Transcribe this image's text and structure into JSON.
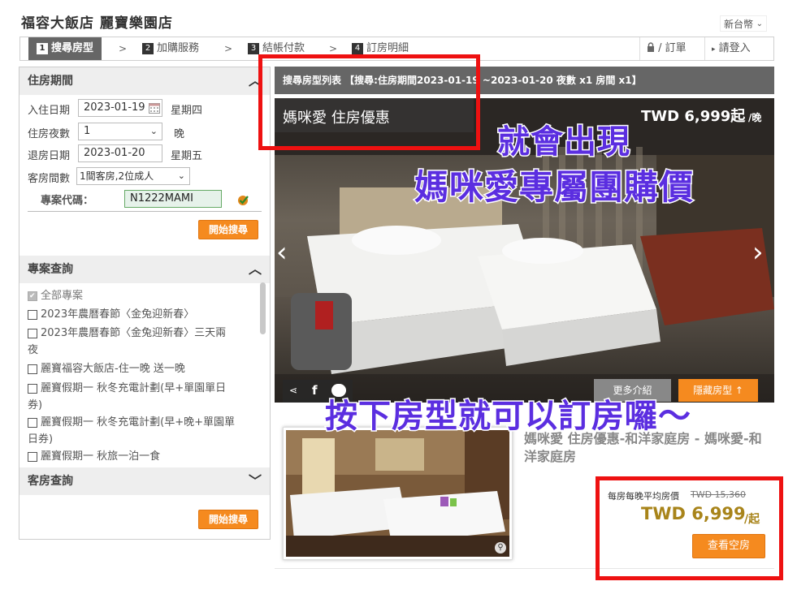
{
  "header": {
    "title": "福容大飯店 麗寶樂園店",
    "currency": "新台幣"
  },
  "steps": [
    {
      "num": "1",
      "label": "搜尋房型"
    },
    {
      "num": "2",
      "label": "加購服務"
    },
    {
      "num": "3",
      "label": "結帳付款"
    },
    {
      "num": "4",
      "label": "訂房明細"
    }
  ],
  "step_arrow": ">",
  "topright": {
    "order": "/ 訂單",
    "login": "請登入"
  },
  "stay": {
    "heading": "住房期間",
    "checkin_label": "入住日期",
    "checkin_value": "2023-01-19",
    "checkin_weekday": "星期四",
    "nights_label": "住房夜數",
    "nights_value": "1",
    "nights_unit": "晚",
    "checkout_label": "退房日期",
    "checkout_value": "2023-01-20",
    "checkout_weekday": "星期五",
    "rooms_label": "客房間數",
    "rooms_value": "1間客房,2位成人",
    "promo_label": "專案代碼：",
    "promo_value": "N1222MAMI",
    "search_btn": "開始搜尋"
  },
  "projects": {
    "heading": "專案查詢",
    "items": [
      "全部專案",
      "2023年農曆春節〈金兔迎新春〉",
      "2023年農曆春節〈金兔迎新春〉三天兩夜",
      "麗寶福容大飯店-住一晚 送一晚",
      "麗寶假期一 秋冬充電計劃(早+單園單日券)",
      "麗寶假期一 秋冬充電計劃(早+晚+單園單日券)",
      "麗寶假期一 秋旅一泊一食"
    ]
  },
  "room_query": {
    "heading": "客房查詢",
    "search_btn": "開始搜尋"
  },
  "listing": {
    "bar": "搜尋房型列表 【搜尋:住房期間2023-01-19 ~2023-01-20 夜數 x1 房間 x1】",
    "hero_caption": "媽咪愛 住房優惠",
    "hero_price": "TWD 6,999起",
    "hero_price_unit": "/晚",
    "more_btn": "更多介紹",
    "hide_btn": "隱藏房型 ↑",
    "room_name": "媽咪愛 住房優惠-和洋家庭房 - 媽咪愛-和洋家庭房",
    "avg_label": "每房每晚平均房價",
    "old_price": "TWD 15,360",
    "price": "TWD 6,999",
    "price_unit": "/起",
    "check_btn": "查看空房"
  },
  "annotations": {
    "line1": "就會出現",
    "line2": "媽咪愛專屬團購價",
    "line3": "按下房型就可以訂房囉～"
  },
  "colors": {
    "accent": "#f58a1f",
    "price": "#a8841a",
    "annotation": "#5b2ee0",
    "highlight": "#ee1111"
  }
}
